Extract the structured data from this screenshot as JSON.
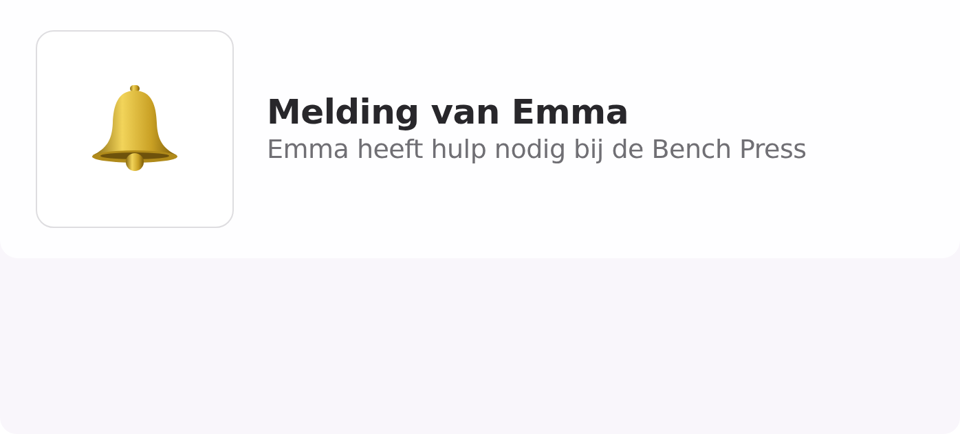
{
  "notification": {
    "title": "Melding van Emma",
    "message": "Emma heeft hulp nodig bij de Bench Press"
  }
}
